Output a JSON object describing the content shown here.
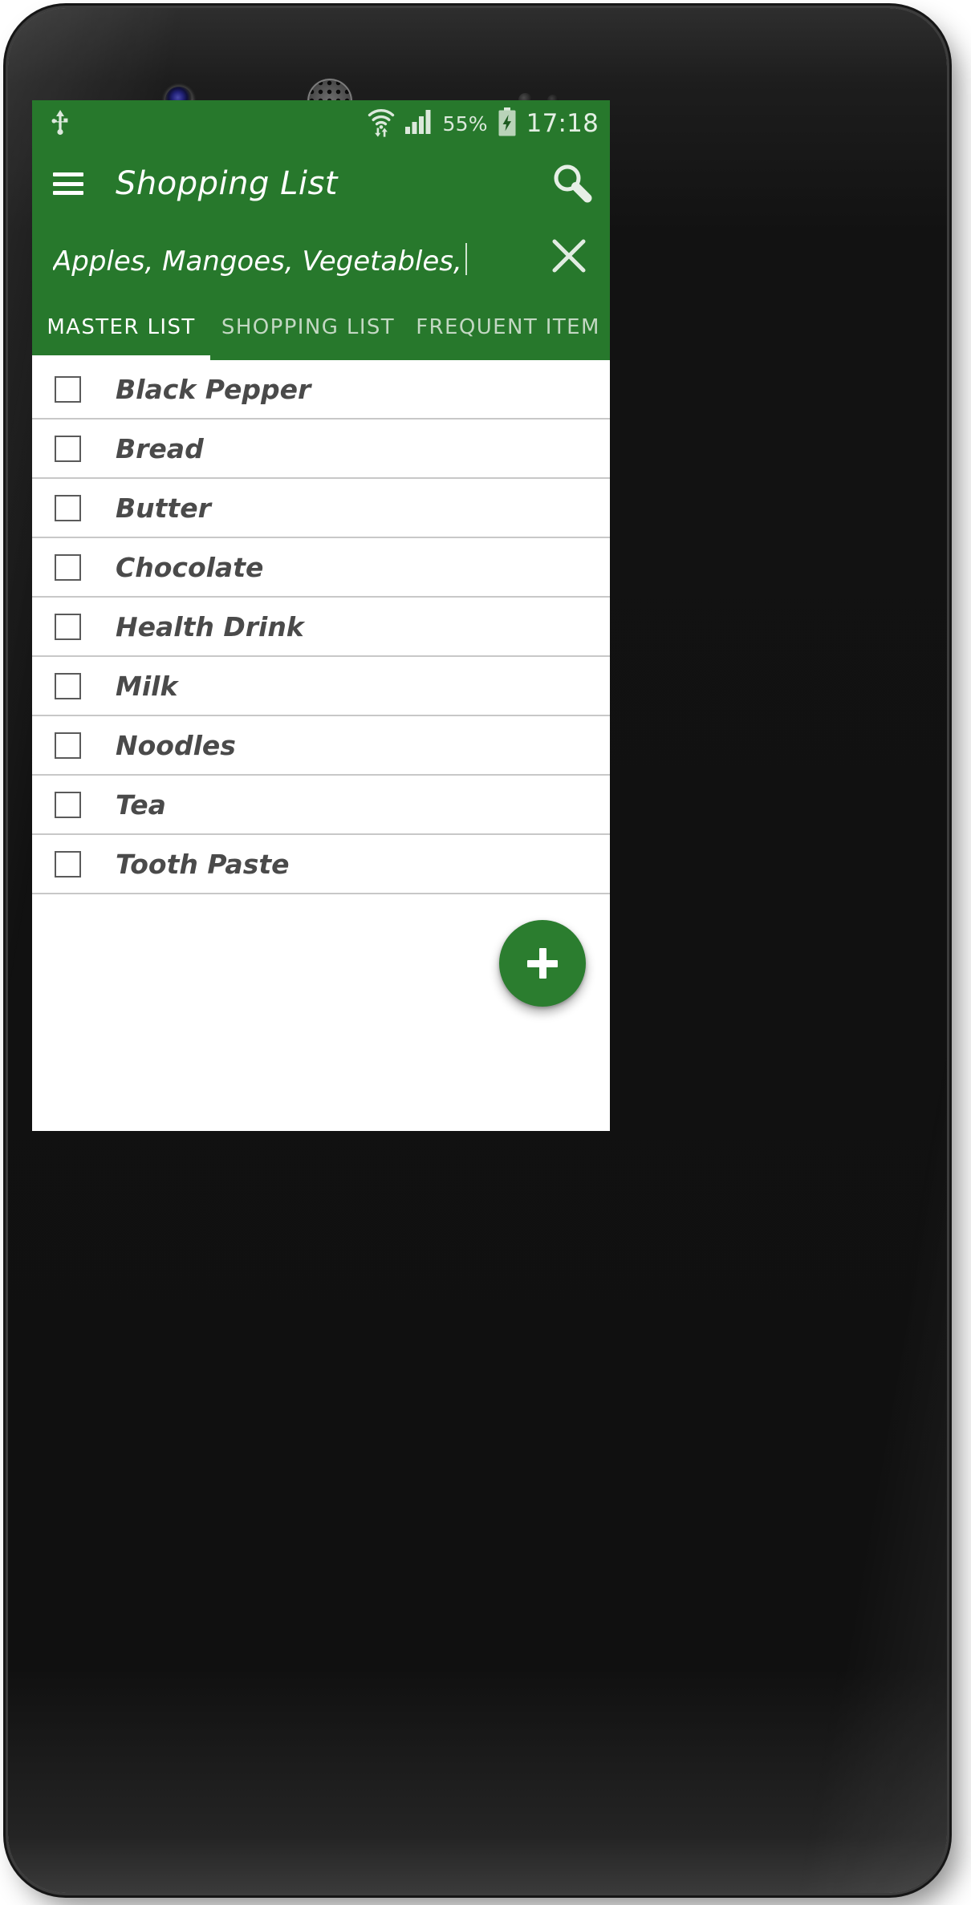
{
  "device": {
    "hardware": {
      "front_camera": "front-camera",
      "earpiece": "earpiece-speaker",
      "proximity_sensor": "proximity-sensor",
      "light_sensor": "ambient-light-sensor"
    }
  },
  "status_bar": {
    "usb_icon": "usb-icon",
    "wifi_icon": "wifi-transfer-icon",
    "signal_icon": "cellular-signal-icon",
    "battery_percent": "55%",
    "battery_icon": "battery-charging-icon",
    "clock": "17:18",
    "background_color": "#27782C",
    "text_color": "#DCE9DC"
  },
  "app_bar": {
    "menu_icon": "hamburger-menu-icon",
    "title": "Shopping List",
    "search_icon": "search-icon",
    "background_color": "#27782C"
  },
  "search": {
    "value": "Apples, Mangoes, Vegetables, ",
    "placeholder": "Search",
    "clear_icon": "close-icon",
    "caret_visible": true
  },
  "tabs": {
    "active_index": 0,
    "items": [
      {
        "label": "MASTER LIST",
        "active": true
      },
      {
        "label": "SHOPPING LIST",
        "active": false
      },
      {
        "label": "FREQUENT ITEM",
        "active": false
      }
    ]
  },
  "list": {
    "items": [
      {
        "label": "Black Pepper",
        "checked": false
      },
      {
        "label": "Bread",
        "checked": false
      },
      {
        "label": "Butter",
        "checked": false
      },
      {
        "label": "Chocolate",
        "checked": false
      },
      {
        "label": "Health Drink",
        "checked": false
      },
      {
        "label": "Milk",
        "checked": false
      },
      {
        "label": "Noodles",
        "checked": false
      },
      {
        "label": "Tea",
        "checked": false
      },
      {
        "label": "Tooth Paste",
        "checked": false
      }
    ]
  },
  "fab": {
    "icon": "plus-icon",
    "label": "+",
    "color": "#2B7D2F"
  }
}
